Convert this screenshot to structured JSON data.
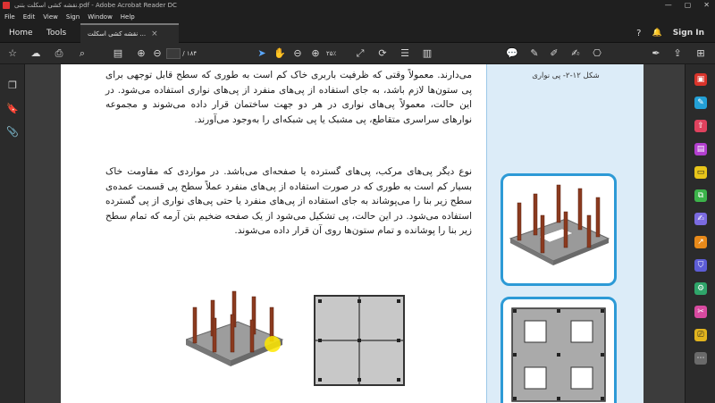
{
  "window": {
    "title": "نقشه‌ کشی اسکلت بتنی.pdf - Adobe Acrobat Reader DC",
    "minimize": "—",
    "maximize": "▢",
    "close": "✕"
  },
  "menu": [
    "File",
    "Edit",
    "View",
    "Sign",
    "Window",
    "Help"
  ],
  "tabs": {
    "home": "Home",
    "tools": "Tools",
    "document": "نقشه کشی اسکلت ...",
    "document_close": "×"
  },
  "header_right": {
    "help": "?",
    "bell": "🔔",
    "signin": "Sign In"
  },
  "toolbar": {
    "page_sep": "/",
    "page_total": "۱۸۴",
    "zoom": "۲۵٪"
  },
  "page": {
    "para1": "می‌دارند. معمولاً وقتی که ظرفیت باربری خاک کم است به طوری که سطح قابل توجهی برای پی ستون‌ها لازم باشد، به جای استفاده از پی‌های منفرد از پی‌های نواری استفاده می‌شود. در این حالت، معمولاً پی‌های نواری در هر دو جهت ساختمان قرار داده می‌شوند و مجموعه نوارهای سراسری متقاطع، پی مشبک یا پی شبکه‌ای را به‌وجود می‌آورند.",
    "para2": "نوع دیگر پی‌های مرکب، پی‌های گسترده یا صفحه‌ای می‌باشد. در مواردی که مقاومت خاک بسیار کم است به طوری که در صورت استفاده از پی‌های منفرد عملاً سطح پی قسمت عمده‌ی سطح زیر بنا را می‌پوشاند به جای استفاده از پی‌های منفرد یا حتی پی‌های نواری از پی گسترده استفاده می‌شود. در این حالت، پی تشکیل می‌شود از یک صفحه ضخیم بتن آرمه که تمام سطح زیر بنا را پوشانده و تمام ستون‌ها روی آن قرار داده می‌شوند.",
    "side_caption": "شکل ۱۲-۲- پی نواری"
  }
}
